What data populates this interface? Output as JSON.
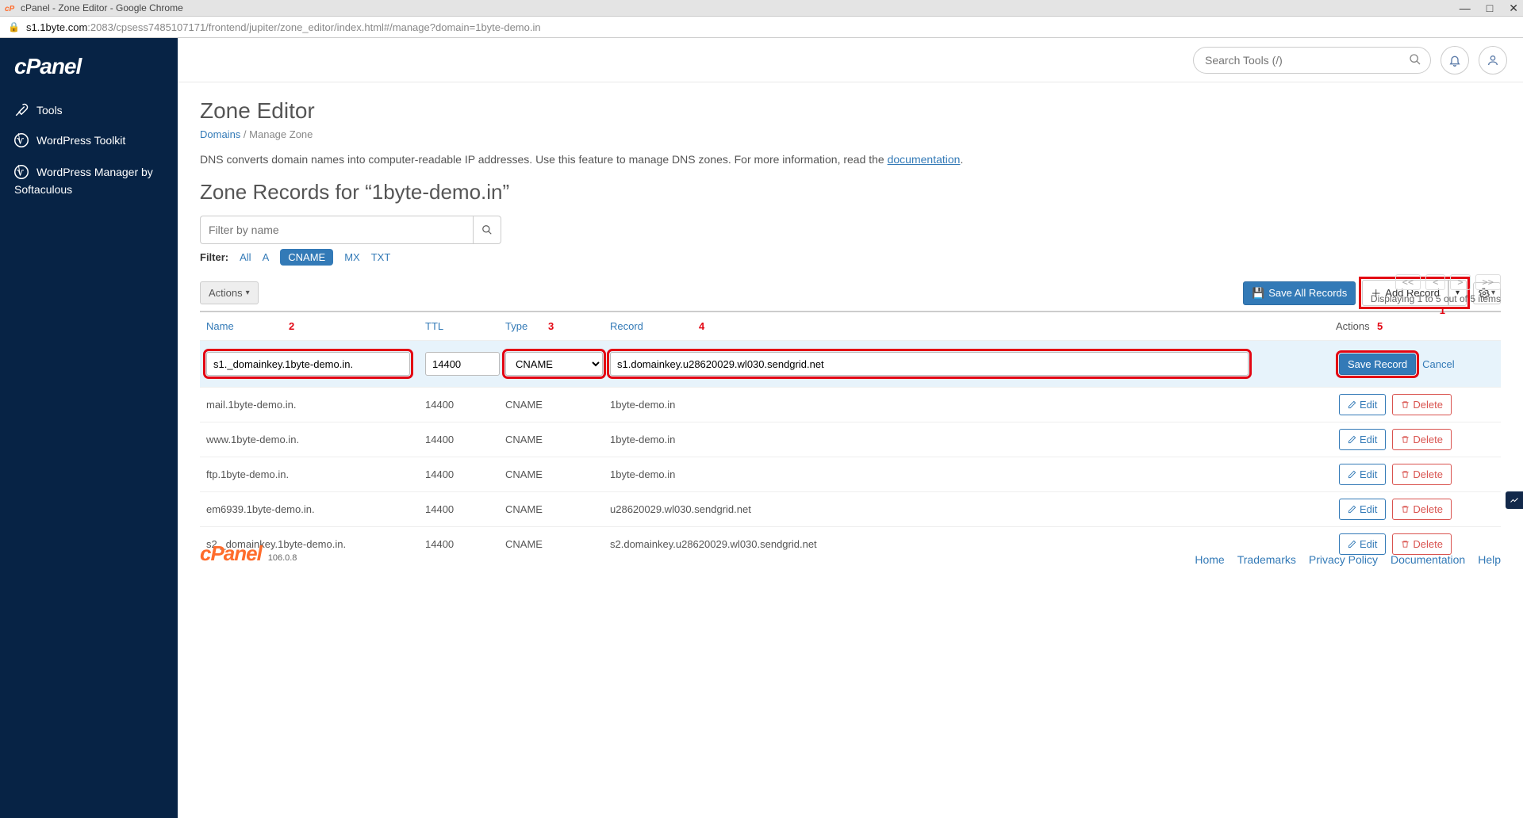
{
  "window": {
    "title": "cPanel - Zone Editor - Google Chrome",
    "url_host": "s1.1byte.com",
    "url_path": ":2083/cpsess7485107171/frontend/jupiter/zone_editor/index.html#/manage?domain=1byte-demo.in"
  },
  "sidebar": {
    "logo": "cPanel",
    "items": [
      {
        "label": "Tools",
        "icon": "tools-icon"
      },
      {
        "label": "WordPress Toolkit",
        "icon": "wordpress-icon"
      },
      {
        "label_l1": "WordPress Manager by",
        "label_l2": "Softaculous",
        "icon": "wordpress-icon"
      }
    ]
  },
  "topbar": {
    "search_placeholder": "Search Tools (/)"
  },
  "page": {
    "title": "Zone Editor",
    "breadcrumb_link": "Domains",
    "breadcrumb_sep": "/",
    "breadcrumb_current": "Manage Zone",
    "intro_pre": "DNS converts domain names into computer-readable IP addresses. Use this feature to manage DNS zones. For more information, read the ",
    "intro_link": "documentation",
    "intro_post": ".",
    "zone_title": "Zone Records for “1byte-demo.in”",
    "filter_placeholder": "Filter by name",
    "filter_label": "Filter:",
    "filter_types": [
      "All",
      "A",
      "CNAME",
      "MX",
      "TXT"
    ],
    "filter_active": "CNAME",
    "actions_label": "Actions",
    "save_all_label": "Save All Records",
    "add_record_label": "Add Record",
    "display_text": "Displaying 1 to 5 out of 5 items",
    "pager": [
      "<<",
      "<",
      ">",
      ">>"
    ]
  },
  "annotations": {
    "add_record": "1",
    "name_col": "2",
    "type_col": "3",
    "record_col": "4",
    "actions_col": "5"
  },
  "table": {
    "headers": {
      "name": "Name",
      "ttl": "TTL",
      "type": "Type",
      "record": "Record",
      "actions": "Actions"
    },
    "editing_row": {
      "name": "s1._domainkey.1byte-demo.in.",
      "ttl": "14400",
      "type": "CNAME",
      "record": "s1.domainkey.u28620029.wl030.sendgrid.net",
      "save_label": "Save Record",
      "cancel_label": "Cancel"
    },
    "rows": [
      {
        "name": "mail.1byte-demo.in.",
        "ttl": "14400",
        "type": "CNAME",
        "record": "1byte-demo.in"
      },
      {
        "name": "www.1byte-demo.in.",
        "ttl": "14400",
        "type": "CNAME",
        "record": "1byte-demo.in"
      },
      {
        "name": "ftp.1byte-demo.in.",
        "ttl": "14400",
        "type": "CNAME",
        "record": "1byte-demo.in"
      },
      {
        "name": "em6939.1byte-demo.in.",
        "ttl": "14400",
        "type": "CNAME",
        "record": "u28620029.wl030.sendgrid.net"
      },
      {
        "name": "s2._domainkey.1byte-demo.in.",
        "ttl": "14400",
        "type": "CNAME",
        "record": "s2.domainkey.u28620029.wl030.sendgrid.net"
      }
    ],
    "edit_label": "Edit",
    "delete_label": "Delete"
  },
  "footer": {
    "logo": "cPanel",
    "version": "106.0.8",
    "links": [
      "Home",
      "Trademarks",
      "Privacy Policy",
      "Documentation",
      "Help"
    ]
  }
}
